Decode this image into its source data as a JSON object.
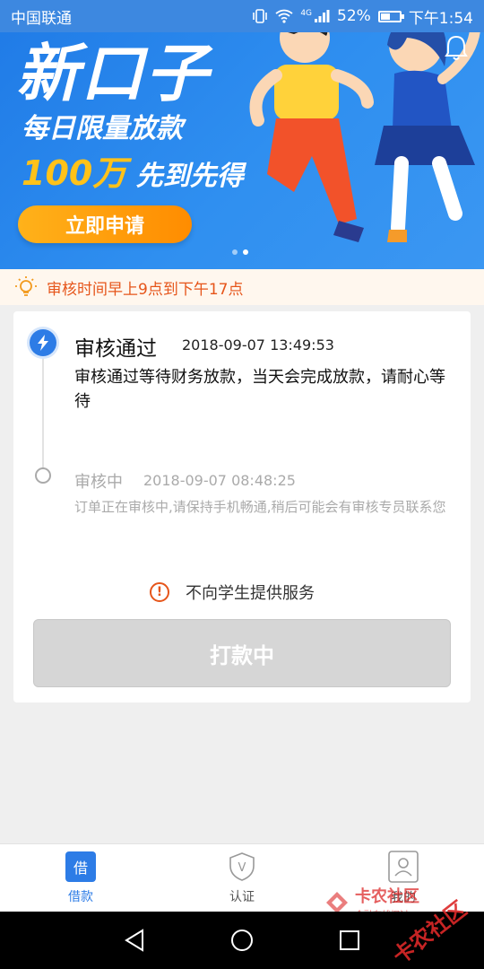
{
  "status_bar": {
    "carrier": "中国联通",
    "battery": "52%",
    "battery_level": 0.52,
    "network": "4G",
    "time": "下午1:54"
  },
  "banner": {
    "headline": "新口子",
    "line2": "每日限量放款",
    "line3_number": "100万",
    "line3_text": "先到先得",
    "apply_button": "立即申请",
    "slide_count": 2,
    "active_slide": 1
  },
  "notice": {
    "text": "审核时间早上9点到下午17点"
  },
  "timeline": {
    "steps": [
      {
        "title": "审核通过",
        "time": "2018-09-07 13:49:53",
        "desc": "审核通过等待财务放款，当天会完成放款，请耐心等待",
        "state": "active"
      },
      {
        "title": "审核中",
        "time": "2018-09-07 08:48:25",
        "desc": "订单正在审核中,请保持手机畅通,稍后可能会有审核专员联系您",
        "state": "done"
      }
    ]
  },
  "warning": {
    "text": "不向学生提供服务",
    "icon": "!"
  },
  "pay_button": {
    "label": "打款中"
  },
  "tabs": [
    {
      "label": "借款",
      "icon_text": "借",
      "active": true
    },
    {
      "label": "认证",
      "icon_text": "V",
      "active": false
    },
    {
      "label": "我的",
      "icon_text": "",
      "active": false
    }
  ],
  "watermark": {
    "text": "卡农社区",
    "subtext": "金融在线探讨",
    "diag": "卡农社区"
  },
  "colors": {
    "primary": "#2d7ce6",
    "accent_orange": "#e6551a",
    "button_disabled": "#d6d6d6"
  }
}
